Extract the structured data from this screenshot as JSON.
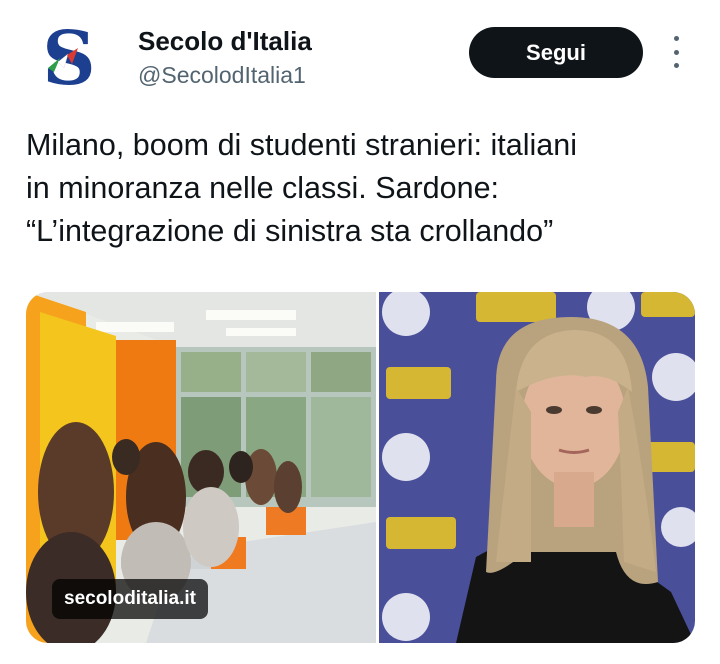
{
  "account": {
    "display_name": "Secolo d'Italia",
    "handle": "@SecolodItalia1",
    "avatar_icon": "secolo-ditalia-logo",
    "avatar_letter": "S"
  },
  "follow_button": {
    "label": "Segui"
  },
  "more_icon": "more-vertical-icon",
  "tweet": {
    "lines": [
      "Milano, boom di studenti stranieri: italiani",
      "in minoranza nelle classi. Sardone:",
      "“L’integrazione di sinistra sta crollando”"
    ]
  },
  "media": {
    "link_domain": "secoloditalia.it",
    "left_image": "classroom-photo",
    "right_image": "woman-portrait-photo"
  },
  "colors": {
    "text": "#0f1419",
    "secondary": "#536471",
    "button": "#0f1419",
    "logo_blue": "#1c3f8f"
  }
}
